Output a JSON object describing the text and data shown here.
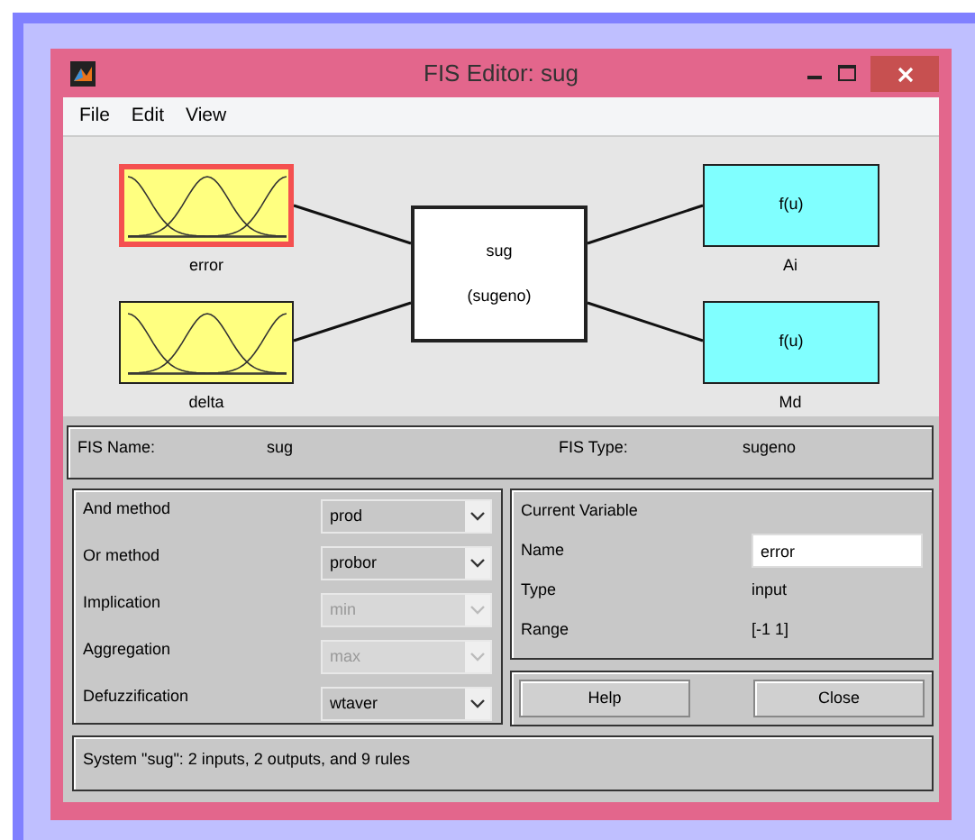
{
  "window": {
    "title": "FIS Editor: sug"
  },
  "menu": [
    "File",
    "Edit",
    "View"
  ],
  "inputs": [
    {
      "name": "error",
      "selected": true
    },
    {
      "name": "delta",
      "selected": false
    }
  ],
  "system": {
    "name": "sug",
    "type": "(sugeno)"
  },
  "outputs": [
    {
      "name": "Ai",
      "function": "f(u)"
    },
    {
      "name": "Md",
      "function": "f(u)"
    }
  ],
  "fis_info": {
    "name_label": "FIS Name:",
    "name": "sug",
    "type_label": "FIS Type:",
    "type": "sugeno"
  },
  "methods": [
    {
      "label": "And method",
      "value": "prod",
      "disabled": false
    },
    {
      "label": "Or method",
      "value": "probor",
      "disabled": false
    },
    {
      "label": "Implication",
      "value": "min",
      "disabled": true
    },
    {
      "label": "Aggregation",
      "value": "max",
      "disabled": true
    },
    {
      "label": "Defuzzification",
      "value": "wtaver",
      "disabled": false
    }
  ],
  "current_variable": {
    "title": "Current Variable",
    "fields": [
      {
        "label": "Name",
        "value": "error",
        "kind": "field"
      },
      {
        "label": "Type",
        "value": "input",
        "kind": "text"
      },
      {
        "label": "Range",
        "value": "[-1 1]",
        "kind": "text"
      }
    ]
  },
  "buttons": [
    "Help",
    "Close"
  ],
  "status": "System \"sug\": 2 inputs, 2 outputs, and 9 rules"
}
